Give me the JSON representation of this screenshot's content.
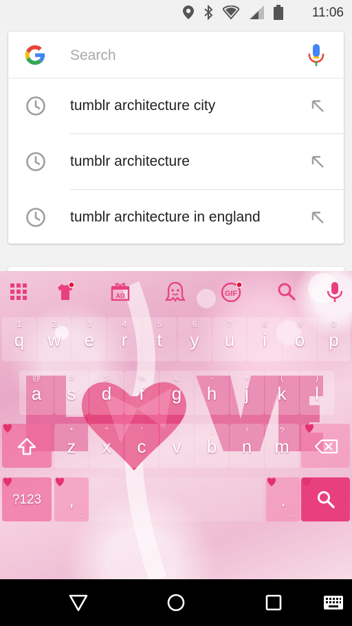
{
  "status_bar": {
    "time": "11:06",
    "icons": [
      "location-icon",
      "bluetooth-icon",
      "wifi-icon",
      "signal-icon",
      "battery-icon"
    ]
  },
  "search": {
    "placeholder": "Search",
    "value": "",
    "logo": "google-logo",
    "mic_icon": "mic-icon"
  },
  "suggestions": [
    {
      "text": "tumblr architecture city",
      "icon": "history-clock-icon",
      "action_icon": "fill-arrow-icon"
    },
    {
      "text": "tumblr architecture",
      "icon": "history-clock-icon",
      "action_icon": "fill-arrow-icon"
    },
    {
      "text": "tumblr architecture in england",
      "icon": "history-clock-icon",
      "action_icon": "fill-arrow-icon"
    }
  ],
  "keyboard": {
    "theme_text": "LOVE",
    "accent_color": "#e8407f",
    "toolbar": [
      "grid-menu-icon",
      "shirt-theme-icon",
      "ad-gift-icon",
      "ghost-sticker-icon",
      "gif-icon",
      "search-icon",
      "mic-icon"
    ],
    "row1": [
      {
        "key": "q",
        "hint": "1"
      },
      {
        "key": "w",
        "hint": "2"
      },
      {
        "key": "e",
        "hint": "3"
      },
      {
        "key": "r",
        "hint": "4"
      },
      {
        "key": "t",
        "hint": "5"
      },
      {
        "key": "y",
        "hint": "6"
      },
      {
        "key": "u",
        "hint": "7"
      },
      {
        "key": "i",
        "hint": "8"
      },
      {
        "key": "o",
        "hint": "9"
      },
      {
        "key": "p",
        "hint": "0"
      }
    ],
    "row2": [
      {
        "key": "a",
        "hint": "@"
      },
      {
        "key": "s",
        "hint": "#"
      },
      {
        "key": "d",
        "hint": "$"
      },
      {
        "key": "f",
        "hint": "%"
      },
      {
        "key": "g",
        "hint": "&"
      },
      {
        "key": "h",
        "hint": "-"
      },
      {
        "key": "j",
        "hint": "+"
      },
      {
        "key": "k",
        "hint": "("
      },
      {
        "key": "l",
        "hint": ")"
      }
    ],
    "row3": [
      {
        "key": "z",
        "hint": "*"
      },
      {
        "key": "x",
        "hint": "\""
      },
      {
        "key": "c",
        "hint": "'"
      },
      {
        "key": "v",
        "hint": ":"
      },
      {
        "key": "b",
        "hint": ";"
      },
      {
        "key": "n",
        "hint": "!"
      },
      {
        "key": "m",
        "hint": "?"
      }
    ],
    "symbols_label": "?123",
    "comma_label": ",",
    "period_label": ".",
    "ellipsis": "…"
  },
  "nav_bar": [
    "back-icon",
    "home-icon",
    "recents-icon",
    "keyboard-switch-icon"
  ]
}
